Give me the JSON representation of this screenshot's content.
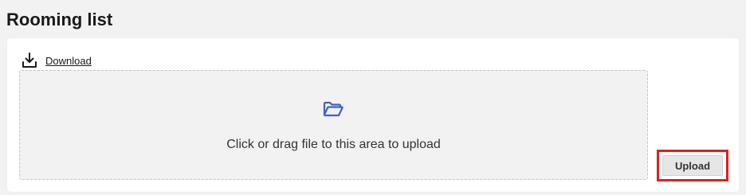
{
  "page": {
    "title": "Rooming list"
  },
  "download": {
    "label": "Download",
    "icon": "download-icon"
  },
  "dropzone": {
    "icon": "folder-open-icon",
    "text": "Click or drag file to this area to upload"
  },
  "upload": {
    "label": "Upload",
    "highlight_color": "#e01e1e"
  },
  "colors": {
    "accent": "#3f63c7",
    "background": "#f2f2f2",
    "card": "#ffffff"
  }
}
